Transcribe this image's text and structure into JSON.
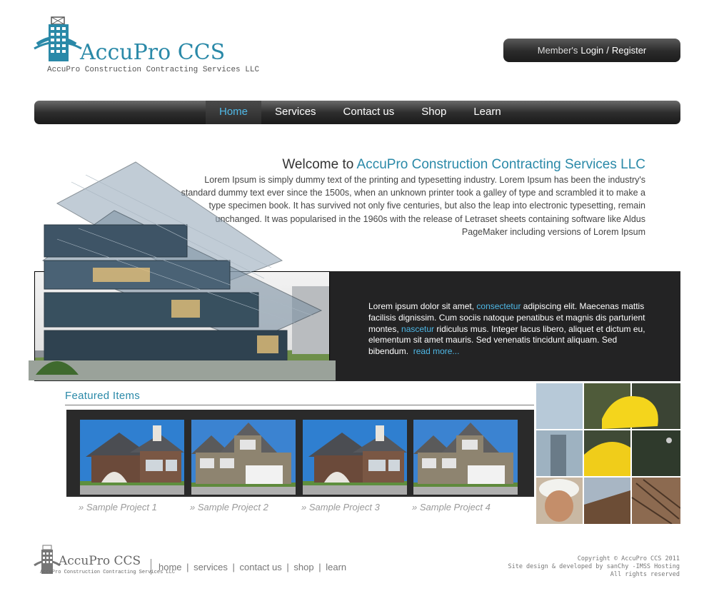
{
  "brand": {
    "name": "AccuPro CCS",
    "tagline": "AccuPro Construction Contracting Services LLC",
    "accent": "#2a89a8",
    "link_blue": "#4fb8e6"
  },
  "member": {
    "prefix": "Member's",
    "login": "Login",
    "slash": "/",
    "register": "Register"
  },
  "nav": {
    "items": [
      "Home",
      "Services",
      "Contact us",
      "Shop",
      "Learn"
    ],
    "active": "Home"
  },
  "welcome": {
    "title_prefix": "Welcome to",
    "title_highlight": "AccuPro Construction Contracting Services LLC",
    "body": "Lorem Ipsum is simply dummy text of the printing and typesetting industry. Lorem Ipsum has been the industry's standard dummy text ever since the 1500s, when an unknown printer took a galley of type and scrambled it to make a type specimen book. It has survived not only five centuries, but also the leap into electronic typesetting, remain unchanged. It was popularised in the 1960s with the release of Letraset sheets containing software like Aldus PageMaker including versions of Lorem Ipsum"
  },
  "promo": {
    "t1": "Lorem ipsum dolor sit amet,",
    "link1": "consectetur",
    "t2": "adipiscing elit. Maecenas mattis facilisis dignissim. Cum sociis natoque penatibus et magnis dis parturient montes,",
    "link2": "nascetur",
    "t3": "ridiculus mus. Integer lacus libero, aliquet et dictum eu, elementum sit amet mauris. Sed venenatis tincidunt aliquam. Sed bibendum.",
    "read_more": "read more..."
  },
  "featured": {
    "title": "Featured Items",
    "projects": [
      "Sample Project 1",
      "Sample Project 2",
      "Sample Project 3",
      "Sample Project 4"
    ],
    "chevron": "»"
  },
  "footer": {
    "logo_name": "AccuPro CCS",
    "logo_tagline": "AccuPro Construction Contracting Services LLC",
    "links": [
      "home",
      "services",
      "contact us",
      "shop",
      "learn"
    ],
    "sep": "|",
    "copyright": "Copyright © AccuPro CCS 2011",
    "credit": "Site design & developed by sanChy -IMSS Hosting",
    "rights": "All rights reserved"
  }
}
